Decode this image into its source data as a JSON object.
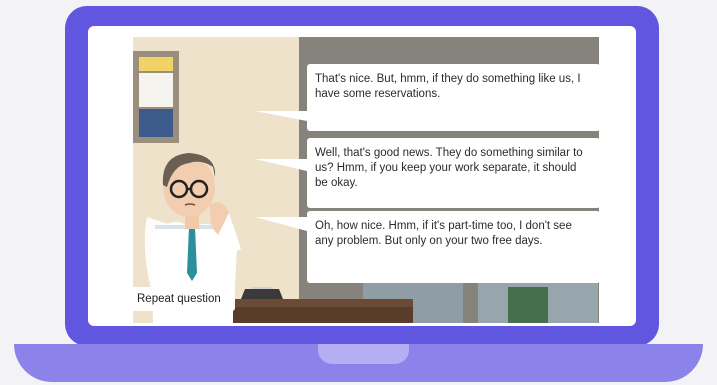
{
  "video": {
    "bubbles": [
      "That's nice. But, hmm, if they do something like us, I have some reservations.",
      "Well, that's good news. They do something similar to us? Hmm, if you keep your work separate, it should be okay.",
      "Oh, how nice. Hmm, if it's part-time too, I don't see any problem. But only on your two free days."
    ],
    "repeat_label": "Repeat question"
  },
  "colors": {
    "laptop_lid": "#6056df",
    "laptop_base": "#8c83ea",
    "wall_left": "#efe2cb",
    "room_right": "#8d8a86"
  }
}
